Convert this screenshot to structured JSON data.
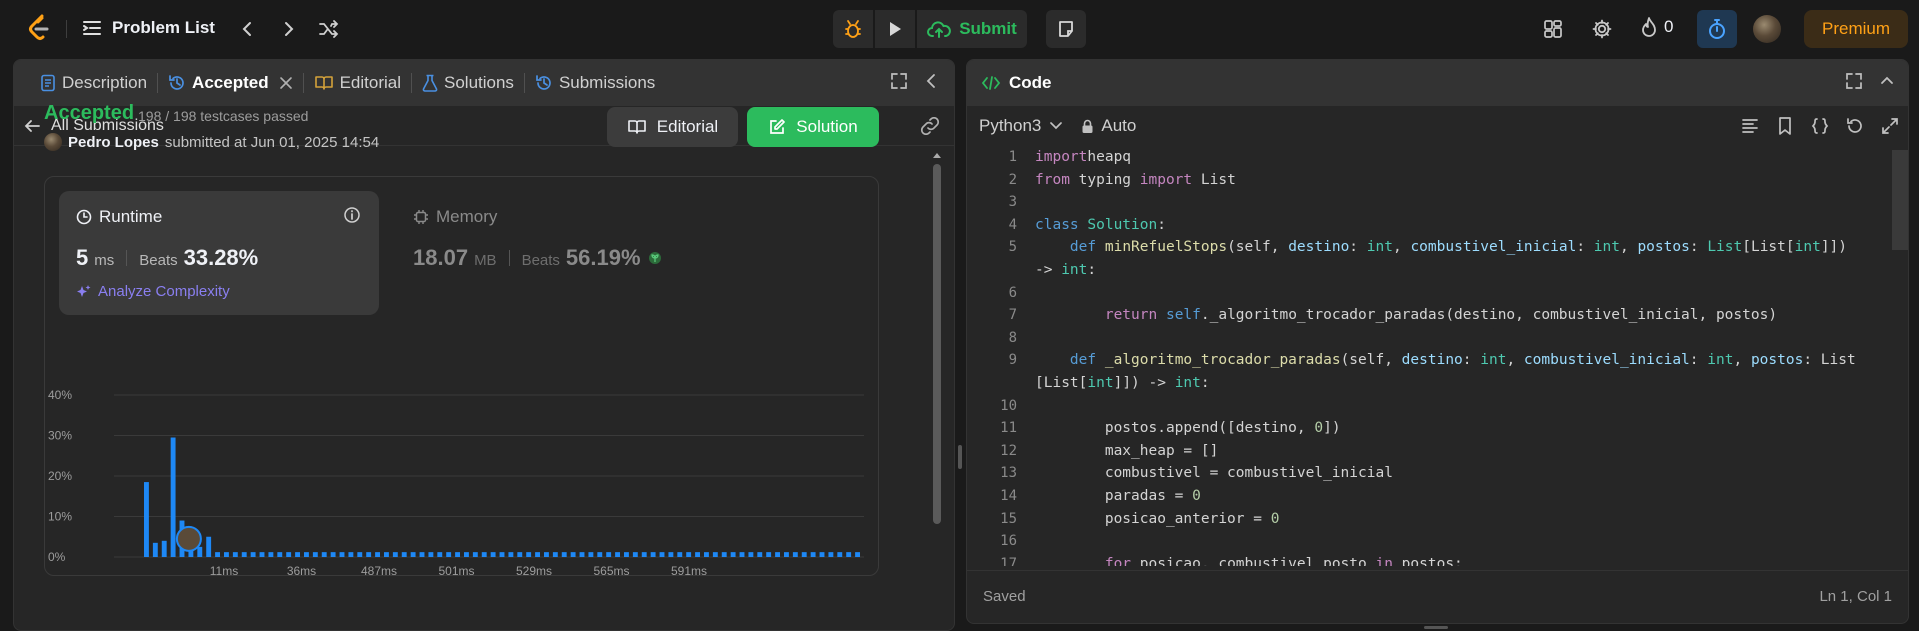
{
  "topbar": {
    "problem_list": "Problem List",
    "submit": "Submit",
    "streak": "0",
    "premium": "Premium"
  },
  "left": {
    "tabs": [
      {
        "label": "Description",
        "icon": "description-icon"
      },
      {
        "label": "Accepted",
        "icon": "history-icon",
        "active": true
      },
      {
        "label": "Editorial",
        "icon": "book-icon"
      },
      {
        "label": "Solutions",
        "icon": "flask-icon"
      },
      {
        "label": "Submissions",
        "icon": "history-icon"
      }
    ],
    "back_label": "All Submissions",
    "status": "Accepted",
    "testcases": "198 / 198 testcases passed",
    "submitter_name": "Pedro Lopes",
    "submitted_text": "submitted at Jun 01, 2025 14:54",
    "editorial_btn": "Editorial",
    "solution_btn": "Solution",
    "runtime": {
      "title": "Runtime",
      "value": "5",
      "unit": "ms",
      "beats_label": "Beats",
      "beats": "33.28%",
      "analyze": "Analyze Complexity"
    },
    "memory": {
      "title": "Memory",
      "value": "18.07",
      "unit": "MB",
      "beats_label": "Beats",
      "beats": "56.19%"
    }
  },
  "chart_data": {
    "type": "bar",
    "y_ticks": [
      "40%",
      "30%",
      "20%",
      "10%",
      "0%"
    ],
    "ylim": [
      0,
      40
    ],
    "x_ticks": [
      "11ms",
      "36ms",
      "487ms",
      "501ms",
      "529ms",
      "565ms",
      "591ms"
    ],
    "values": [
      18.5,
      3.5,
      4.0,
      29.5,
      9.0,
      3.0,
      2.5,
      5.0,
      1.2,
      1.2,
      1.2,
      1.2,
      1.2,
      1.2,
      1.2,
      1.2,
      1.2,
      1.2,
      1.2,
      1.2,
      1.2,
      1.2,
      1.2,
      1.2,
      1.2,
      1.2,
      1.2,
      1.2,
      1.2,
      1.2,
      1.2,
      1.2,
      1.2,
      1.2,
      1.2,
      1.2,
      1.2,
      1.2,
      1.2,
      1.2,
      1.2,
      1.2,
      1.2,
      1.2,
      1.2,
      1.2,
      1.2,
      1.2,
      1.2,
      1.2,
      1.2,
      1.2,
      1.2,
      1.2,
      1.2,
      1.2,
      1.2,
      1.2,
      1.2,
      1.2,
      1.2,
      1.2,
      1.2,
      1.2,
      1.2,
      1.2,
      1.2,
      1.2,
      1.2,
      1.2,
      1.2,
      1.2,
      1.2,
      1.2,
      1.2,
      1.2,
      1.2,
      1.2,
      1.2,
      1.2,
      1.2
    ],
    "bar_color": "#1e88f5",
    "highlight_index": 5
  },
  "right": {
    "title": "Code",
    "language": "Python3",
    "auto": "Auto",
    "status": "Saved",
    "cursor": "Ln 1, Col 1",
    "line_numbers": [
      "1",
      "2",
      "3",
      "4",
      "5",
      "",
      "6",
      "7",
      "8",
      "9",
      "",
      "10",
      "11",
      "12",
      "13",
      "14",
      "15",
      "16",
      "17"
    ],
    "code": [
      [
        [
          "kw",
          "import"
        ],
        [
          "",
          "heapq"
        ]
      ],
      [
        [
          "kw",
          "from"
        ],
        [
          "",
          " typing "
        ],
        [
          "kw",
          "import"
        ],
        [
          "",
          " List"
        ]
      ],
      [],
      [
        [
          "kw2",
          "class"
        ],
        [
          "",
          " "
        ],
        [
          "cls",
          "Solution"
        ],
        [
          "",
          ":"
        ]
      ],
      [
        [
          "",
          "    "
        ],
        [
          "kw2",
          "def"
        ],
        [
          "",
          " "
        ],
        [
          "fn",
          "minRefuelStops"
        ],
        [
          "",
          "(self, "
        ],
        [
          "prm",
          "destino"
        ],
        [
          "",
          ": "
        ],
        [
          "ty",
          "int"
        ],
        [
          "",
          ", "
        ],
        [
          "prm",
          "combustivel_inicial"
        ],
        [
          "",
          ": "
        ],
        [
          "ty",
          "int"
        ],
        [
          "",
          ", "
        ],
        [
          "prm",
          "postos"
        ],
        [
          "",
          ": "
        ],
        [
          "ty",
          "List"
        ],
        [
          "",
          "[List["
        ],
        [
          "ty",
          "int"
        ],
        [
          "",
          "]])"
        ]
      ],
      [
        [
          "",
          "-> "
        ],
        [
          "ty",
          "int"
        ],
        [
          "",
          ":"
        ]
      ],
      [],
      [
        [
          "",
          "        "
        ],
        [
          "kw",
          "return"
        ],
        [
          "",
          " "
        ],
        [
          "kw2",
          "self"
        ],
        [
          "",
          "._algoritmo_trocador_paradas(destino, combustivel_inicial, postos)"
        ]
      ],
      [],
      [
        [
          "",
          "    "
        ],
        [
          "kw2",
          "def"
        ],
        [
          "",
          " "
        ],
        [
          "fn",
          "_algoritmo_trocador_paradas"
        ],
        [
          "",
          "(self, "
        ],
        [
          "prm",
          "destino"
        ],
        [
          "",
          ": "
        ],
        [
          "ty",
          "int"
        ],
        [
          "",
          ", "
        ],
        [
          "prm",
          "combustivel_inicial"
        ],
        [
          "",
          ": "
        ],
        [
          "ty",
          "int"
        ],
        [
          "",
          ", "
        ],
        [
          "prm",
          "postos"
        ],
        [
          "",
          ": List"
        ]
      ],
      [
        [
          "",
          "[List["
        ],
        [
          "ty",
          "int"
        ],
        [
          "",
          "]]) -> "
        ],
        [
          "ty",
          "int"
        ],
        [
          "",
          ":"
        ]
      ],
      [],
      [
        [
          "",
          "        postos.append([destino, "
        ],
        [
          "numc",
          "0"
        ],
        [
          "",
          "])"
        ]
      ],
      [
        [
          "",
          "        max_heap = []"
        ]
      ],
      [
        [
          "",
          "        combustivel = combustivel_inicial"
        ]
      ],
      [
        [
          "",
          "        paradas = "
        ],
        [
          "numc",
          "0"
        ]
      ],
      [
        [
          "",
          "        posicao_anterior = "
        ],
        [
          "numc",
          "0"
        ]
      ],
      [],
      [
        [
          "",
          "        "
        ],
        [
          "kw",
          "for"
        ],
        [
          "",
          " posicao, combustivel_posto "
        ],
        [
          "kw",
          "in"
        ],
        [
          "",
          " postos:"
        ]
      ]
    ]
  }
}
